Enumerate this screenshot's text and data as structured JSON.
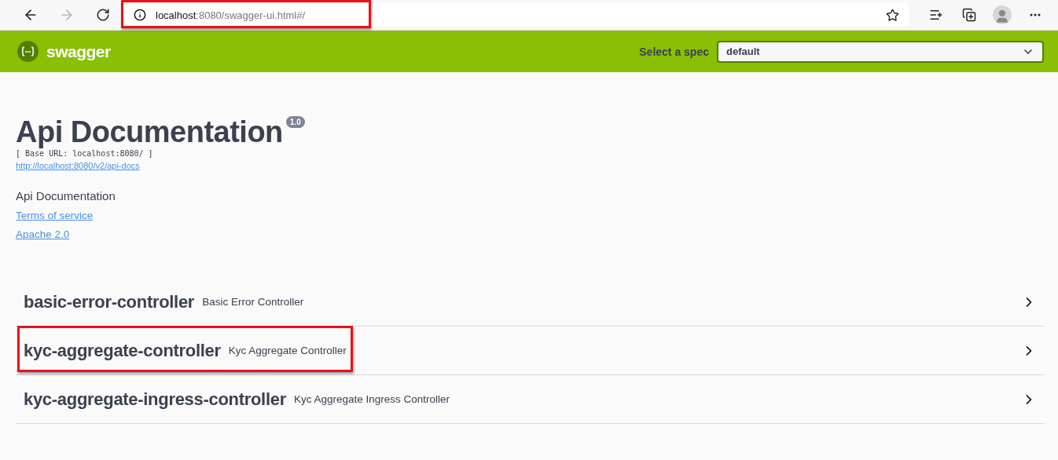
{
  "browser": {
    "url_host": "localhost",
    "url_rest": ":8080/swagger-ui.html#/",
    "url_highlighted": true,
    "forward_disabled": true
  },
  "topbar": {
    "brand": "swagger",
    "spec_label": "Select a spec",
    "spec_value": "default"
  },
  "info": {
    "title": "Api Documentation",
    "version": "1.0",
    "base_url": "[ Base URL: localhost:8080/ ]",
    "docs_link": "http://localhost:8080/v2/api-docs",
    "description": "Api Documentation",
    "links": [
      "Terms of service",
      "Apache 2.0"
    ]
  },
  "tags": [
    {
      "name": "basic-error-controller",
      "description": "Basic Error Controller",
      "highlighted": false
    },
    {
      "name": "kyc-aggregate-controller",
      "description": "Kyc Aggregate Controller",
      "highlighted": true
    },
    {
      "name": "kyc-aggregate-ingress-controller",
      "description": "Kyc Aggregate Ingress Controller",
      "highlighted": false
    }
  ]
}
